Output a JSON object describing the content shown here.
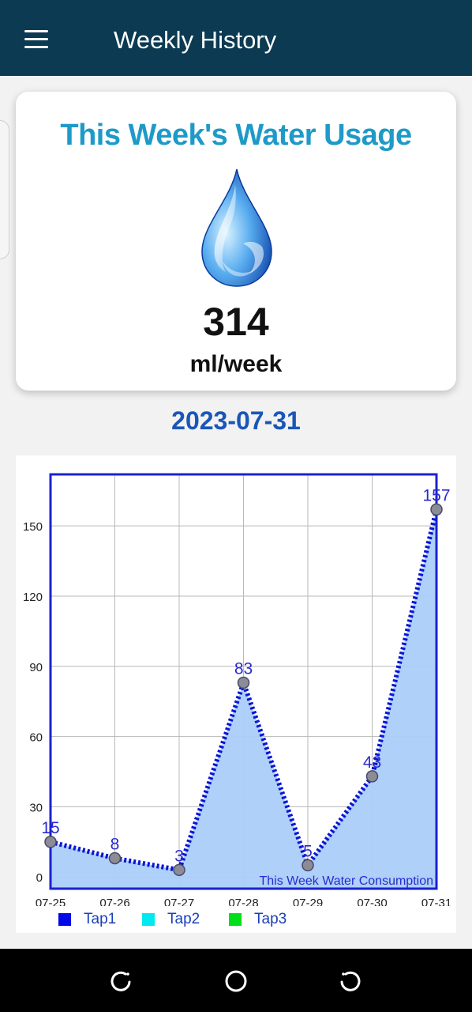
{
  "appbar": {
    "title": "Weekly History"
  },
  "card": {
    "title": "This Week's Water Usage",
    "value": "314",
    "unit": "ml/week"
  },
  "date": "2023-07-31",
  "colors": {
    "appbar": "#0b3a52",
    "title": "#1e9ac8",
    "date": "#1a56b8",
    "line": "#0a14d6",
    "fill": "#aacdf9"
  },
  "chart_data": {
    "type": "area",
    "categories": [
      "07-25",
      "07-26",
      "07-27",
      "07-28",
      "07-29",
      "07-30",
      "07-31"
    ],
    "series": [
      {
        "name": "Tap1",
        "values": [
          15,
          8,
          3,
          83,
          5,
          43,
          157
        ]
      }
    ],
    "data_labels": [
      "15",
      "8",
      "3",
      "83",
      "5",
      "43",
      "157"
    ],
    "y_ticks": [
      "0",
      "30",
      "60",
      "90",
      "120",
      "150"
    ],
    "y_tick_values": [
      0,
      30,
      60,
      90,
      120,
      150
    ],
    "ylim": [
      -5,
      172
    ],
    "annotation": "This Week Water Consumption",
    "grid": true,
    "legend": [
      {
        "label": "Tap1",
        "color": "#0008e8"
      },
      {
        "label": "Tap2",
        "color": "#00e8f0"
      },
      {
        "label": "Tap3",
        "color": "#00e01a"
      }
    ],
    "legend_position": "bottom-left"
  },
  "navbar": {
    "icons": [
      "recent-apps-icon",
      "home-icon",
      "back-icon"
    ]
  }
}
